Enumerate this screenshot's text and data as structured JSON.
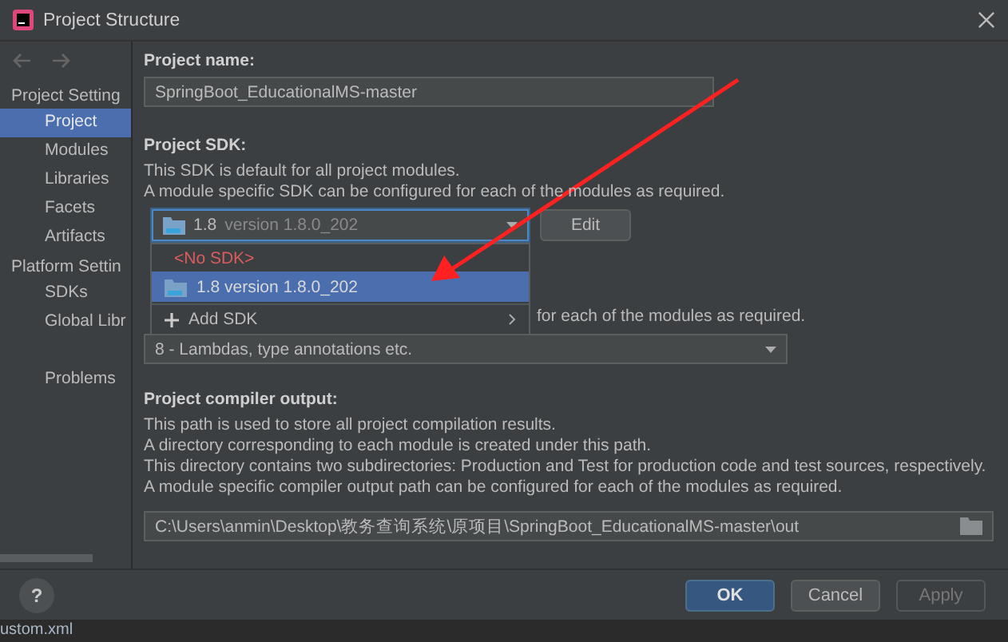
{
  "window": {
    "title": "Project Structure"
  },
  "sidebar": {
    "sections": [
      {
        "label": "Project Setting",
        "items": [
          {
            "label": "Project",
            "selected": true
          },
          {
            "label": "Modules",
            "selected": false
          },
          {
            "label": "Libraries",
            "selected": false
          },
          {
            "label": "Facets",
            "selected": false
          },
          {
            "label": "Artifacts",
            "selected": false
          }
        ]
      },
      {
        "label": "Platform Settin",
        "items": [
          {
            "label": "SDKs",
            "selected": false
          },
          {
            "label": "Global Libr",
            "selected": false
          }
        ]
      }
    ],
    "problems": "Problems"
  },
  "project_name": {
    "label": "Project name:",
    "value": "SpringBoot_EducationalMS-master"
  },
  "project_sdk": {
    "label": "Project SDK:",
    "description": [
      "This SDK is default for all project modules.",
      "A module specific SDK can be configured for each of the modules as required."
    ],
    "combo": {
      "name": "1.8",
      "version": "version 1.8.0_202"
    },
    "edit_button": "Edit",
    "dropdown": [
      {
        "kind": "none",
        "label": "<No SDK>",
        "selected": false
      },
      {
        "kind": "sdk",
        "label": "1.8 version 1.8.0_202",
        "selected": true
      },
      {
        "kind": "add",
        "label": "Add SDK",
        "selected": false
      }
    ]
  },
  "language_level": {
    "description_tail": "for each of the modules as required.",
    "value": "8 - Lambdas, type annotations etc."
  },
  "compiler_output": {
    "label": "Project compiler output:",
    "description": [
      "This path is used to store all project compilation results.",
      "A directory corresponding to each module is created under this path.",
      "This directory contains two subdirectories: Production and Test for production code and test sources, respectively.",
      "A module specific compiler output path can be configured for each of the modules as required."
    ],
    "path": "C:\\Users\\anmin\\Desktop\\教务查询系统\\原项目\\SpringBoot_EducationalMS-master\\out"
  },
  "help_button": "?",
  "buttons": [
    {
      "label": "OK",
      "kind": "default"
    },
    {
      "label": "Cancel",
      "kind": "normal"
    },
    {
      "label": "Apply",
      "kind": "disabled"
    }
  ],
  "background": {
    "file_tab": "ustom.xml"
  }
}
